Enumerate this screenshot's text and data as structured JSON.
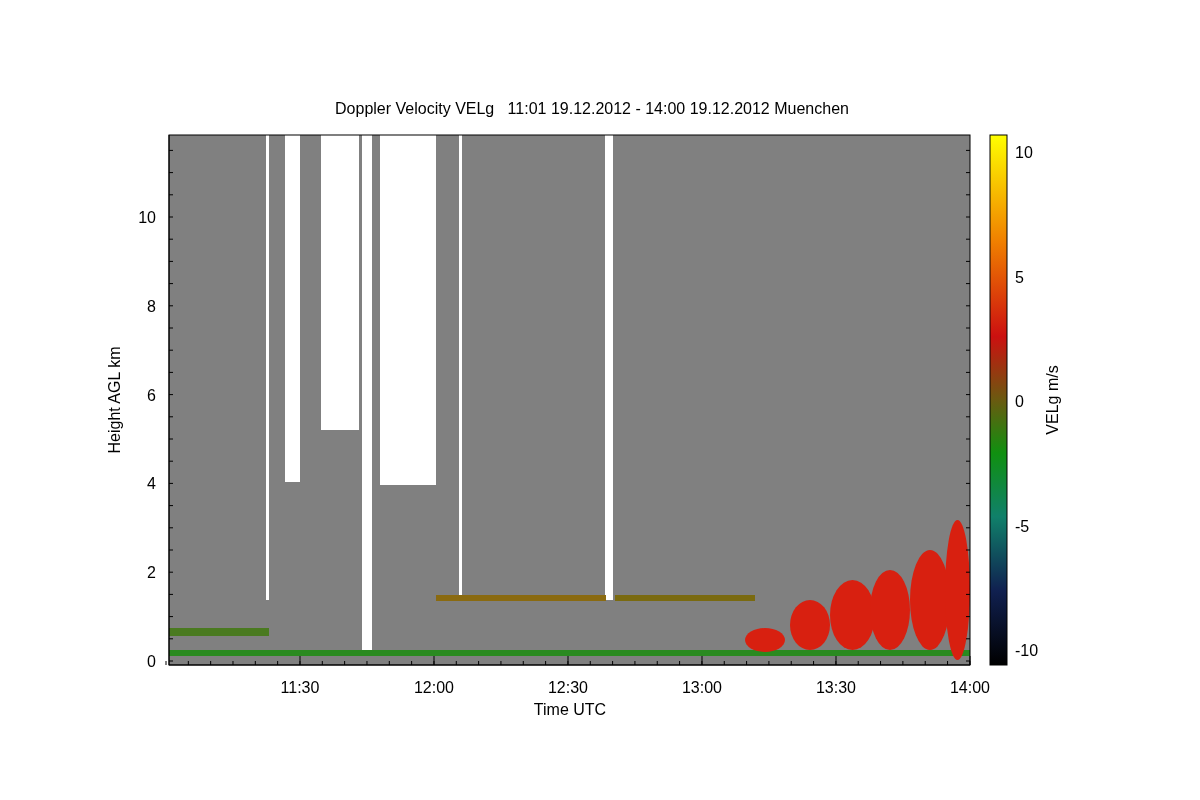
{
  "plot": {
    "title": "Doppler Velocity VELg   11:01 19.12.2012 - 14:00 19.12.2012 Muenchen",
    "x_axis_label": "Time UTC",
    "y_axis_label": "Height AGL km",
    "x_tick_labels": [
      "11:30",
      "12:00",
      "12:30",
      "13:00",
      "13:30",
      "14:00"
    ],
    "y_tick_labels": [
      "10",
      "8",
      "6",
      "4",
      "2",
      "0"
    ]
  },
  "colorbar": {
    "label": "VELg m/s",
    "tick_labels": [
      "10",
      "5",
      "0",
      "-5",
      "-10"
    ]
  }
}
